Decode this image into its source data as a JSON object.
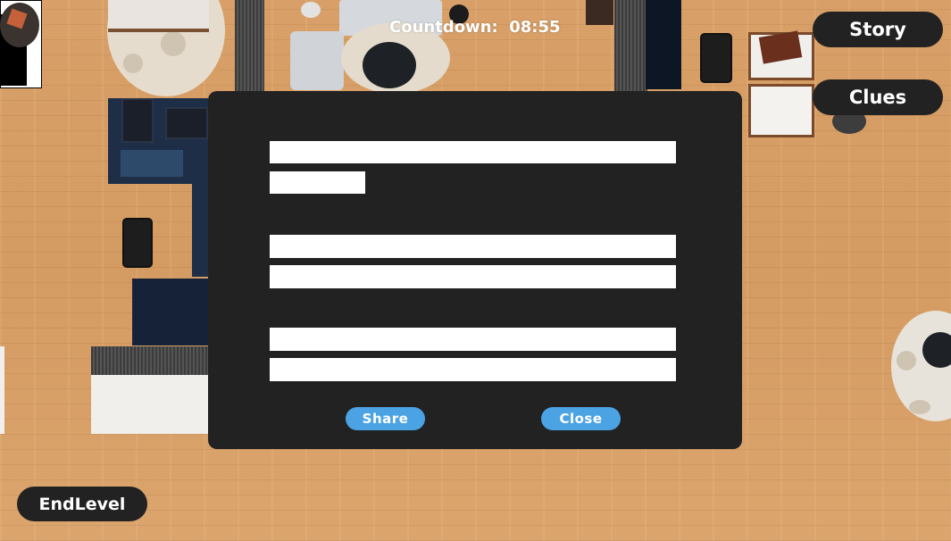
{
  "hud": {
    "countdown_label": "Countdown:",
    "countdown_time": "08:55",
    "story_label": "Story",
    "clues_label": "Clues",
    "endlevel_label": "EndLevel"
  },
  "dialog": {
    "paragraphs": [
      {
        "lines": [
          "",
          ""
        ],
        "redacted": true
      },
      {
        "lines": [
          "",
          ""
        ],
        "redacted": true
      },
      {
        "lines": [
          "",
          ""
        ],
        "redacted": true
      }
    ],
    "share_label": "Share",
    "close_label": "Close"
  },
  "colors": {
    "floor": "#d9a167",
    "panel": "#222222",
    "dialog_button": "#4ba3e3",
    "text": "#ffffff"
  }
}
